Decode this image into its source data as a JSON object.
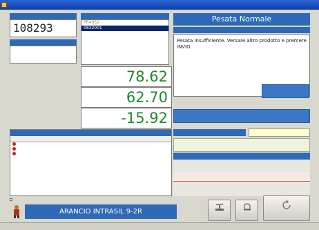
{
  "window": {
    "title": ""
  },
  "left_top": {
    "code_header": "",
    "code_value": "108293",
    "product_header": ""
  },
  "list": {
    "header": "",
    "items": [
      "PR4052",
      "0832001"
    ],
    "selected_index": 1
  },
  "status": {
    "title": "Pesata Normale",
    "subheader": "",
    "message": "Pesata insufficiente. Versare altro prodotto e premere INVIO."
  },
  "quantities": {
    "to_weigh": {
      "label": "",
      "value": "78.62"
    },
    "weighed": {
      "label": "",
      "value": "62.70"
    },
    "difference": {
      "label": "",
      "value": "-15.92"
    }
  },
  "components": {
    "header": "",
    "columns": [
      "",
      "",
      ""
    ],
    "rows": [
      {
        "name": "",
        "qty": "",
        "weighed": ""
      },
      {
        "name": "",
        "qty": "",
        "weighed": ""
      },
      {
        "name": "",
        "qty": "",
        "weighed": ""
      }
    ]
  },
  "weighing_type": {
    "label": "",
    "value": "",
    "info_line1": "",
    "info_line2": ""
  },
  "completion": {
    "header": ""
  },
  "brand": {
    "text": ""
  },
  "bottom": {
    "checkbox_label": "",
    "product_name": "ARANCIO INTRASIL 9-2R",
    "buttons": [
      {
        "label": "",
        "icon": "scale-icon"
      },
      {
        "label": "",
        "icon": "bell-icon"
      },
      {
        "label": "",
        "icon": "refresh-icon"
      }
    ]
  },
  "statusbar": {
    "left": "",
    "middle": "",
    "right": ""
  },
  "colors": {
    "accent_blue": "#2f6ab8",
    "value_green": "#1f8a2a",
    "danger_red": "#c8241c"
  }
}
